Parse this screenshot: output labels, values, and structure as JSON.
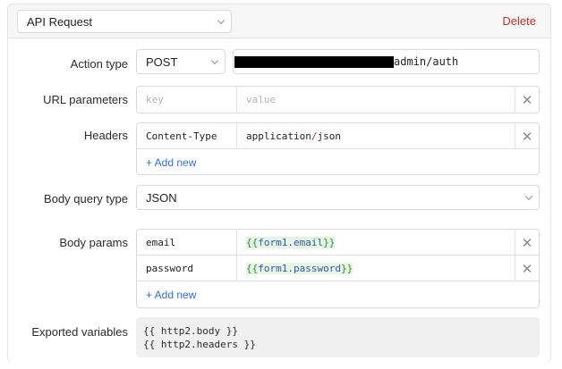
{
  "header": {
    "action_select": "API Request",
    "delete_label": "Delete"
  },
  "action_type": {
    "label": "Action type",
    "method": "POST",
    "url_suffix": "admin/auth"
  },
  "url_parameters": {
    "label": "URL parameters",
    "key_placeholder": "key",
    "value_placeholder": "value"
  },
  "headers": {
    "label": "Headers",
    "rows": [
      {
        "key": "Content-Type",
        "value_part1": "application",
        "value_sep": "/",
        "value_part2": "json"
      }
    ],
    "add_new": "+ Add new"
  },
  "body_query_type": {
    "label": "Body query type",
    "value": "JSON"
  },
  "body_params": {
    "label": "Body params",
    "rows": [
      {
        "key": "email",
        "open": "{{",
        "expr": "form1.email",
        "close": "}}"
      },
      {
        "key": "password",
        "open": "{{",
        "expr": "form1.password",
        "close": "}}"
      }
    ],
    "add_new": "+ Add new"
  },
  "exported_variables": {
    "label": "Exported variables",
    "lines": [
      "{{ http2.body }}",
      "{{ http2.headers }}"
    ]
  },
  "icons": {
    "chevron": "chevron-down-icon",
    "close": "close-icon"
  },
  "colors": {
    "delete": "#c0322e",
    "link": "#2e6fd6",
    "template_brace": "#2f8f2f",
    "template_expr": "#3257a8"
  }
}
